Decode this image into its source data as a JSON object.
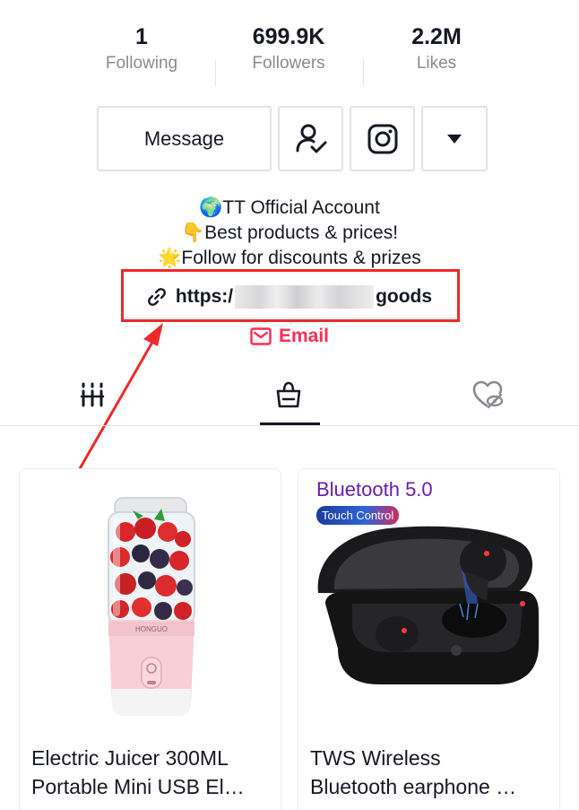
{
  "stats": [
    {
      "value": "1",
      "label": "Following"
    },
    {
      "value": "699.9K",
      "label": "Followers"
    },
    {
      "value": "2.2M",
      "label": "Likes"
    }
  ],
  "actions": {
    "message_label": "Message",
    "following_icon": "user-check-icon",
    "instagram_icon": "instagram-icon",
    "more_icon": "caret-down-icon"
  },
  "bio": {
    "line1": "🌍TT Official Account",
    "line2": "👇Best products & prices!",
    "line3": "🌟Follow for discounts & prizes"
  },
  "link": {
    "prefix": "https:/",
    "suffix": "goods",
    "icon": "link-icon"
  },
  "email": {
    "label": "Email",
    "icon": "mail-icon"
  },
  "tabs": [
    {
      "name": "videos",
      "icon": "grid-bars-icon"
    },
    {
      "name": "shop",
      "icon": "shopping-bag-icon",
      "active": true
    },
    {
      "name": "liked",
      "icon": "heart-hidden-icon"
    }
  ],
  "products": [
    {
      "title_line1": "Electric Juicer 300ML",
      "title_line2": "Portable Mini USB El…",
      "brand_text": "HONGUO"
    },
    {
      "title_line1": "TWS Wireless",
      "title_line2": "Bluetooth earphone …",
      "promo_heading": "Bluetooth 5.0",
      "promo_badge": "Touch Control"
    }
  ],
  "colors": {
    "accent": "#fe2c55",
    "annotation": "#ee2a2a",
    "text": "#161823",
    "muted": "#8a8b91",
    "border": "#e3e3e4"
  }
}
